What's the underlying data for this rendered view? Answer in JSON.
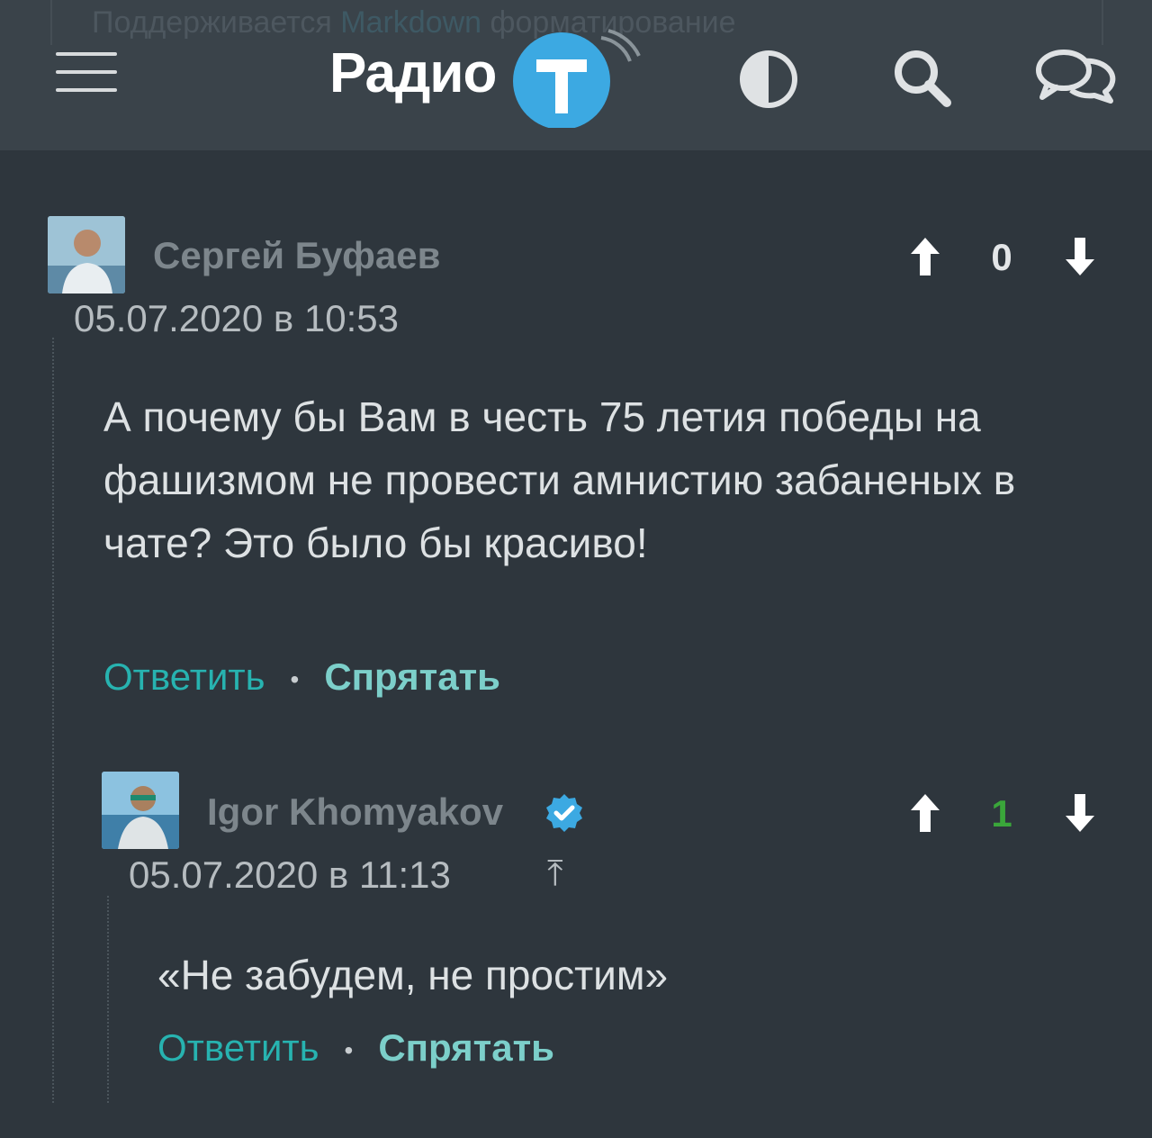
{
  "header": {
    "ghost_text_before": "Поддерживается ",
    "ghost_text_md": "Markdown",
    "ghost_text_after": " форматирование",
    "logo_text": "Радио",
    "logo_letter": "Т",
    "icons": [
      "menu-icon",
      "theme-toggle-icon",
      "search-icon",
      "chat-icon"
    ],
    "accent_color": "#3ca9e2"
  },
  "comments": [
    {
      "author": "Сергей Буфаев",
      "date": "05.07.2020 в 10:53",
      "score": "0",
      "text": "А почему бы Вам в честь 75 летия победы на фашизмом не провести амнистию забаненых в чате? Это было бы красиво!",
      "reply_label": "Ответить",
      "separator": "•",
      "hide_label": "Спрятать"
    },
    {
      "author": "Igor Khomyakov",
      "verified": true,
      "date": "05.07.2020 в 11:13",
      "parent_icon": "⤒",
      "score": "1",
      "score_color": "#3aa63a",
      "text": "«Не забудем, не простим»",
      "reply_label": "Ответить",
      "separator": "•",
      "hide_label": "Спрятать"
    }
  ],
  "colors": {
    "background": "#2e363d",
    "header": "#3a434a",
    "link": "#27b3b0"
  }
}
